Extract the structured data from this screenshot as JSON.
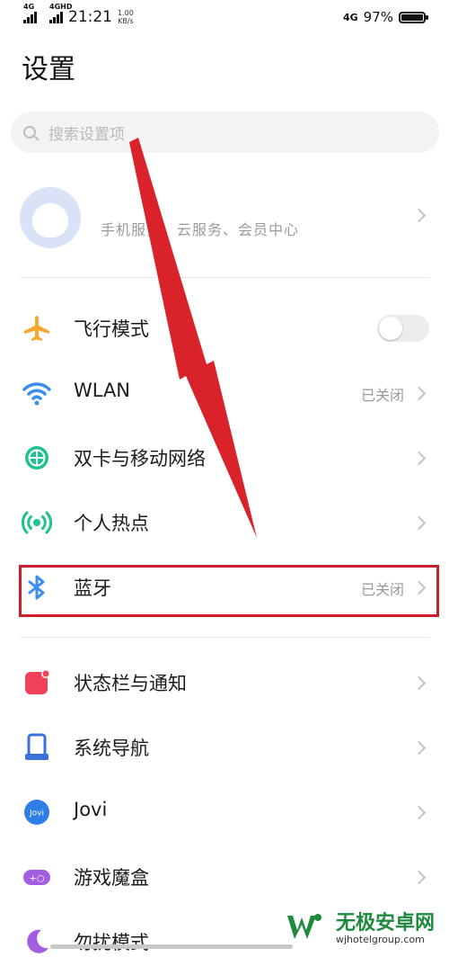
{
  "status_bar": {
    "net1": "4G",
    "net2": "4GHD",
    "time": "21:21",
    "speed_value": "1.00",
    "speed_unit": "KB/s",
    "net_right": "4G",
    "battery": "97%"
  },
  "page": {
    "title": "设置"
  },
  "search": {
    "placeholder": "搜索设置项"
  },
  "account": {
    "label": "手机服务、云服务、会员中心"
  },
  "settings": [
    {
      "id": "airplane",
      "label": "飞行模式",
      "icon": "airplane-icon",
      "color": "#f4a72a",
      "toggle_on": false
    },
    {
      "id": "wlan",
      "label": "WLAN",
      "icon": "wifi-icon",
      "color": "#3a8ff0",
      "value": "已关闭"
    },
    {
      "id": "sim",
      "label": "双卡与移动网络",
      "icon": "globe-icon",
      "color": "#1ec28e"
    },
    {
      "id": "hotspot",
      "label": "个人热点",
      "icon": "hotspot-icon",
      "color": "#1ec28e"
    },
    {
      "id": "bluetooth",
      "label": "蓝牙",
      "icon": "bluetooth-icon",
      "color": "#3a8ff0",
      "value": "已关闭"
    },
    {
      "id": "statusbar",
      "label": "状态栏与通知",
      "icon": "notification-icon",
      "color": "#f0405a"
    },
    {
      "id": "navigation",
      "label": "系统导航",
      "icon": "navigation-icon",
      "color": "#3a72d6"
    },
    {
      "id": "jovi",
      "label": "Jovi",
      "icon": "jovi-icon",
      "color": "#3a8ff0",
      "icon_text": "Jovi"
    },
    {
      "id": "gamebox",
      "label": "游戏魔盒",
      "icon": "gamepad-icon",
      "color": "#a35ee0",
      "icon_text": "+○"
    },
    {
      "id": "dnd",
      "label": "勿扰模式",
      "icon": "moon-icon",
      "color": "#a35ee0"
    }
  ],
  "watermark": {
    "title": "无极安卓网",
    "url": "wjhotelgroup.com"
  },
  "colors": {
    "highlight": "#c8202a",
    "arrow": "#d9222a"
  }
}
